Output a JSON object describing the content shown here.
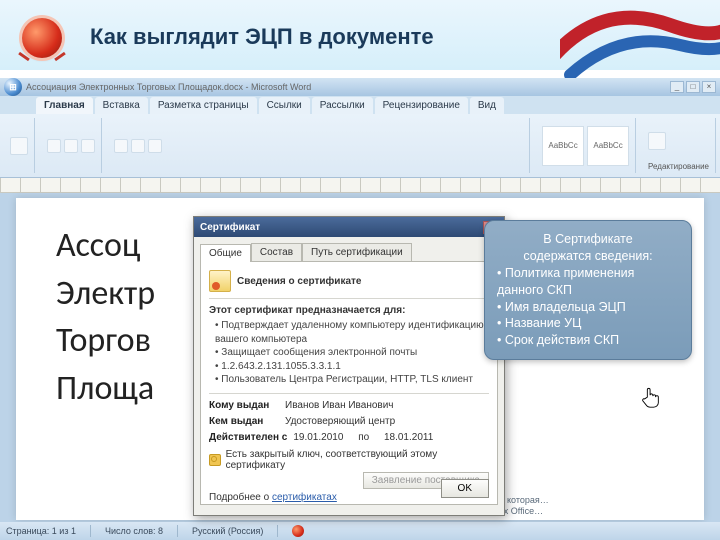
{
  "slide": {
    "title": "Как выглядит ЭЦП в документе"
  },
  "word": {
    "title": "Ассоциация Электронных Торговых Площадок.docx - Microsoft Word",
    "tabs": [
      "Главная",
      "Вставка",
      "Разметка страницы",
      "Ссылки",
      "Рассылки",
      "Рецензирование",
      "Вид"
    ],
    "style_preview": "AaBbCc",
    "edit_label": "Редактирование",
    "doc_lines": [
      "Ассоц",
      "Электр",
      "Торгов",
      "Площа"
    ],
    "status": {
      "page": "Страница: 1 из 1",
      "words": "Число слов: 8",
      "lang": "Русский (Россия)"
    },
    "sig_msg1": "…ованный в документ цифровой подписью, которая…",
    "sig_msg2": "Добавить сведения о подписях в документах Office…"
  },
  "cert": {
    "title": "Сертификат",
    "tabs": [
      "Общие",
      "Состав",
      "Путь сертификации"
    ],
    "header": "Сведения о сертификате",
    "intended_label": "Этот сертификат предназначается для:",
    "purposes": [
      "Подтверждает удаленному компьютеру идентификацию вашего компьютера",
      "Защищает сообщения электронной почты",
      "1.2.643.2.131.1055.3.3.1.1",
      "Пользователь Центра Регистрации, HTTP, TLS клиент"
    ],
    "issued_to_label": "Кому выдан",
    "issued_to": "Иванов Иван Иванович",
    "issued_by_label": "Кем выдан",
    "issued_by": "Удостоверяющий центр",
    "valid_label": "Действителен с",
    "valid_from": "19.01.2010",
    "valid_mid": "по",
    "valid_to": "18.01.2011",
    "key_msg": "Есть закрытый ключ, соответствующий этому сертификату",
    "issuer_btn": "Заявление поставщика",
    "more_prefix": "Подробнее о ",
    "more_link": "сертификатах",
    "ok": "OK"
  },
  "callout": {
    "l1": "В Сертификате",
    "l2": "содержатся сведения:",
    "l3": "• Политика применения данного СКП",
    "l4": "• Имя владельца ЭЦП",
    "l5": "• Название УЦ",
    "l6": "• Срок действия СКП"
  }
}
